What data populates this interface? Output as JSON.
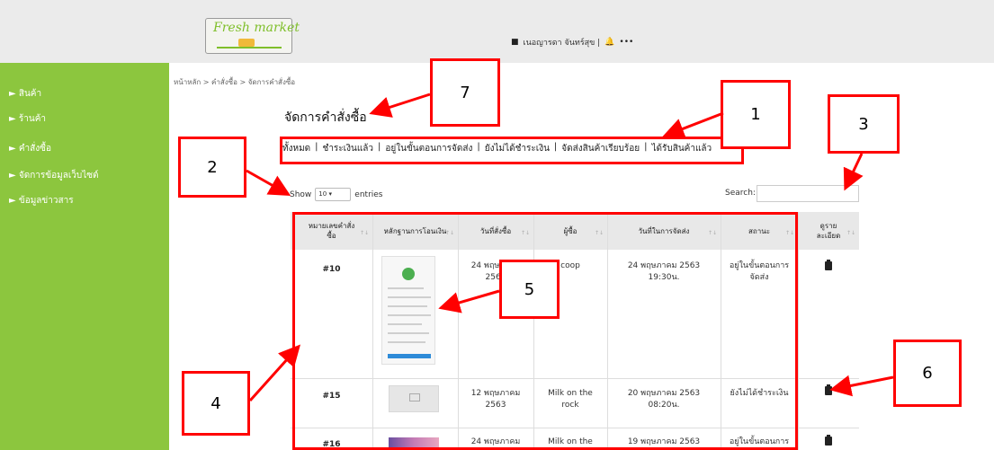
{
  "header": {
    "logo_text": "Fresh market",
    "user_name": "เนอญารดา จันทร์สุข |",
    "bell_glyph": "🔔",
    "more_glyph": "•••"
  },
  "sidebar": {
    "items": [
      {
        "label": "► สินค้า"
      },
      {
        "label": "► ร้านค้า"
      },
      {
        "label": "► คำสั่งซื้อ"
      },
      {
        "label": "► จัดการข้อมูลเว็บไซต์"
      },
      {
        "label": "► ข้อมูลข่าวสาร"
      }
    ]
  },
  "breadcrumb": "หน้าหลัก > คำสั่งซื้อ > จัดการคำสั่งซื้อ",
  "page_title": "จัดการคำสั่งซื้อ",
  "filters": [
    "ทั้งหมด",
    "ชำระเงินแล้ว",
    "อยู่ในขั้นตอนการจัดส่ง",
    "ยังไม่ได้ชำระเงิน",
    "จัดส่งสินค้าเรียบร้อย",
    "ได้รับสินค้าแล้ว"
  ],
  "filter_separator": "|",
  "table_controls": {
    "show_label": "Show",
    "entries_value": "10",
    "entries_label": "entries",
    "search_label": "Search:"
  },
  "table": {
    "headers": [
      "หมายเลขคำสั่งซื้อ",
      "หลักฐานการโอนเงิน",
      "วันที่สั่งซื้อ",
      "ผู้ซื้อ",
      "วันที่ในการจัดส่ง",
      "สถานะ",
      "ดูรายละเอียด"
    ],
    "rows": [
      {
        "id": "#10",
        "order_date": "24 พฤษภาคม 2563",
        "buyer": "coop",
        "delivery": "24 พฤษภาคม 2563 19:30น.",
        "status": "อยู่ในขั้นตอนการจัดส่ง"
      },
      {
        "id": "#15",
        "order_date": "12 พฤษภาคม 2563",
        "buyer": "Milk on the rock",
        "delivery": "20 พฤษภาคม 2563 08:20น.",
        "status": "ยังไม่ได้ชำระเงิน"
      },
      {
        "id": "#16",
        "order_date": "24 พฤษภาคม",
        "buyer": "Milk on the",
        "delivery": "19 พฤษภาคม 2563",
        "status": "อยู่ในขั้นตอนการจัด"
      }
    ]
  },
  "annotations": [
    "1",
    "2",
    "3",
    "4",
    "5",
    "6",
    "7"
  ],
  "colors": {
    "sidebar": "#8cc63e",
    "annotation": "#ff0000",
    "header_bg": "#ebebeb"
  }
}
